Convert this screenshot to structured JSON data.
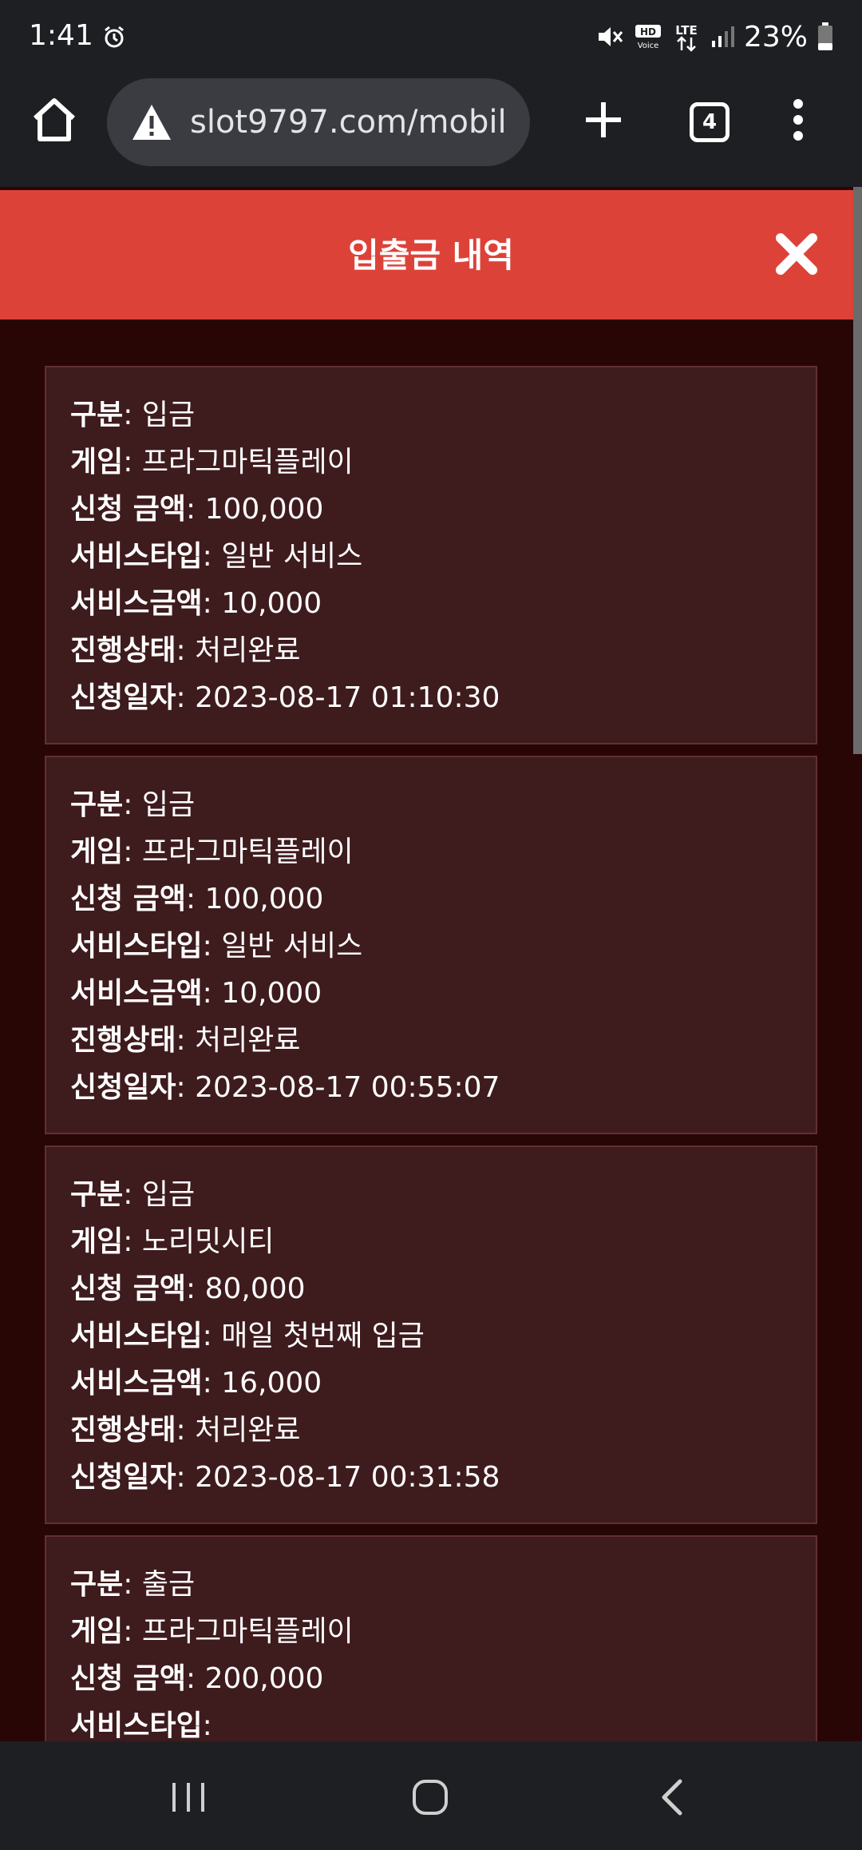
{
  "status_bar": {
    "time": "1:41",
    "battery": "23%",
    "icons": [
      "alarm-icon",
      "mute-icon",
      "hd-voice-icon",
      "lte-icon",
      "signal-icon",
      "battery-icon"
    ]
  },
  "browser": {
    "url": "slot9797.com/mobil",
    "tab_count": "4",
    "icons": [
      "home-icon",
      "warning-icon",
      "plus-icon",
      "tabs-icon",
      "more-vertical-icon"
    ]
  },
  "modal": {
    "title": "입출금 내역",
    "close_icon": "close-icon"
  },
  "labels": {
    "type": "구분",
    "game": "게임",
    "amount": "신청 금액",
    "service_type": "서비스타입",
    "service_amount": "서비스금액",
    "status": "진행상태",
    "date": "신청일자"
  },
  "records": [
    {
      "type": "입금",
      "game": "프라그마틱플레이",
      "amount": "100,000",
      "service_type": "일반 서비스",
      "service_amount": "10,000",
      "status": "처리완료",
      "date": "2023-08-17 01:10:30"
    },
    {
      "type": "입금",
      "game": "프라그마틱플레이",
      "amount": "100,000",
      "service_type": "일반 서비스",
      "service_amount": "10,000",
      "status": "처리완료",
      "date": "2023-08-17 00:55:07"
    },
    {
      "type": "입금",
      "game": "노리밋시티",
      "amount": "80,000",
      "service_type": "매일 첫번째 입금",
      "service_amount": "16,000",
      "status": "처리완료",
      "date": "2023-08-17 00:31:58"
    },
    {
      "type": "출금",
      "game": "프라그마틱플레이",
      "amount": "200,000",
      "service_type": ""
    }
  ],
  "nav_bar": {
    "icons": [
      "recent-apps-icon",
      "home-circle-icon",
      "back-icon"
    ]
  },
  "colors": {
    "header_red": "#dd4239",
    "page_bg": "#280606",
    "card_bg": "#3e1b1d",
    "system_bar": "#1e1f22"
  }
}
